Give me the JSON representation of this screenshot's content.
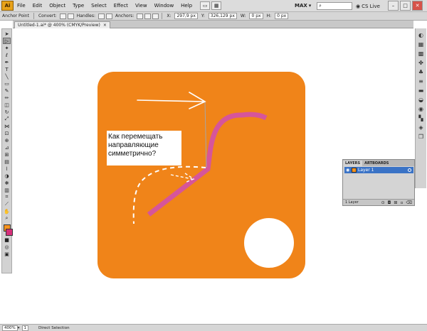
{
  "menubar": {
    "logo": "Ai",
    "items": [
      "File",
      "Edit",
      "Object",
      "Type",
      "Select",
      "Effect",
      "View",
      "Window",
      "Help"
    ],
    "workspace": "MAX",
    "cs_live": "CS Live"
  },
  "controlbar": {
    "label": "Anchor Point",
    "convert": "Convert:",
    "handles": "Handles:",
    "anchors": "Anchors:",
    "x_label": "X:",
    "x_value": "297,9 px",
    "y_label": "Y:",
    "y_value": "326,129 px",
    "w_label": "W:",
    "w_value": "0 px",
    "h_label": "H:",
    "h_value": "0 px"
  },
  "document": {
    "tab_title": "Untitled-1.ai* @ 400% (CMYK/Preview)",
    "tab_close": "×"
  },
  "artwork": {
    "note_text": "Как перемещать направляющие симметрично?",
    "colors": {
      "background": "#f08419",
      "path": "#d6559a",
      "guides": "#ffffff"
    }
  },
  "layers_panel": {
    "tabs": [
      "LAYERS",
      "ARTBOARDS"
    ],
    "layer_name": "Layer 1",
    "footer_count": "1 Layer"
  },
  "statusbar": {
    "zoom": "400%",
    "page": "1",
    "tool": "Direct Selection"
  },
  "icons": {
    "tools": [
      "selection-icon",
      "direct-selection-icon",
      "magic-wand-icon",
      "lasso-icon",
      "pen-icon",
      "type-icon",
      "line-icon",
      "rectangle-icon",
      "paintbrush-icon",
      "pencil-icon",
      "eraser-icon",
      "rotate-icon",
      "scale-icon",
      "width-icon",
      "free-transform-icon",
      "shape-builder-icon",
      "perspective-icon",
      "mesh-icon",
      "gradient-icon",
      "eyedropper-icon",
      "blend-icon",
      "symbol-sprayer-icon",
      "graph-icon",
      "artboard-icon",
      "slice-icon",
      "hand-icon",
      "zoom-icon"
    ]
  }
}
